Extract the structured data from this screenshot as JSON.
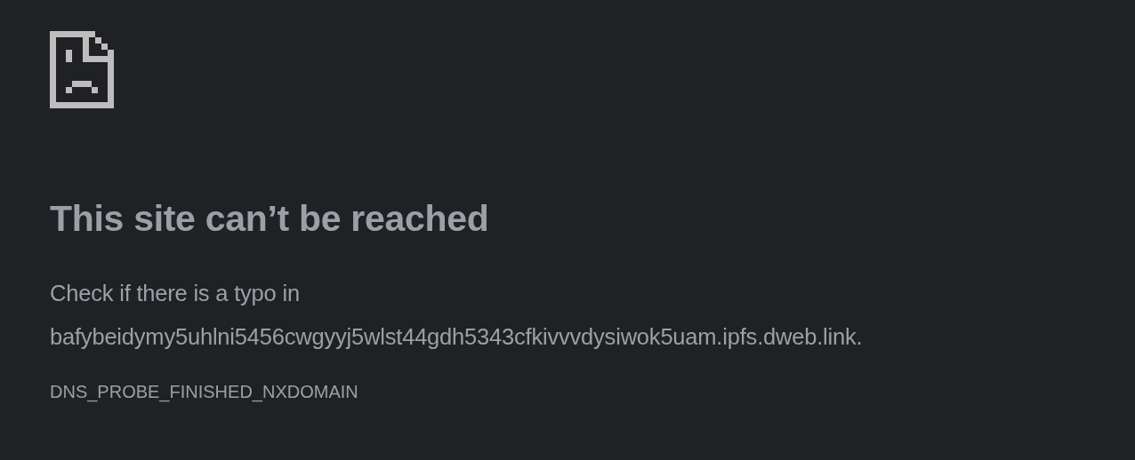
{
  "heading": "This site can’t be reached",
  "message": "Check if there is a typo in",
  "url": "bafybeidymy5uhlni5456cwgyyj5wlst44gdh5343cfkivvvdysiwok5uam.ipfs.dweb.link.",
  "error_code": "DNS_PROBE_FINISHED_NXDOMAIN"
}
